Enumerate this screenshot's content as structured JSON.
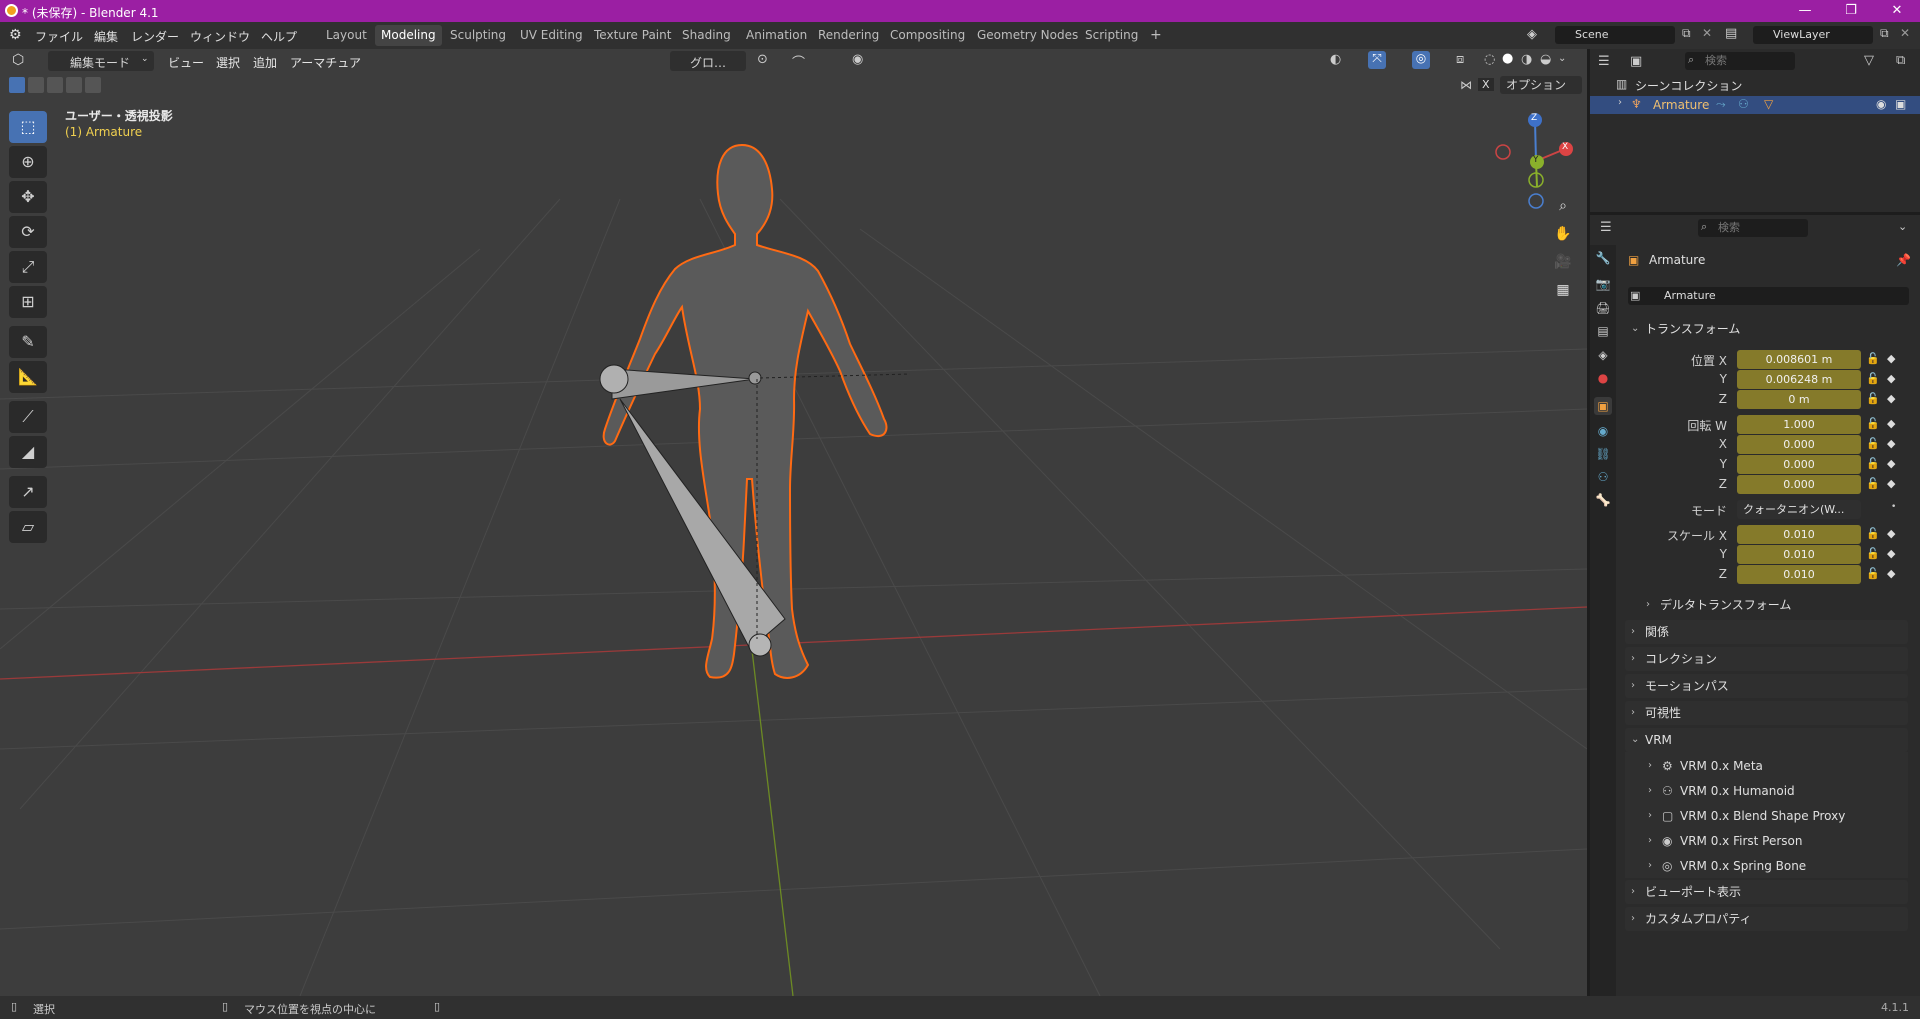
{
  "window": {
    "title": "* (未保存) - Blender 4.1",
    "minimize": "—",
    "restore": "❐",
    "close": "✕"
  },
  "menu": {
    "items": [
      "ファイル",
      "編集",
      "レンダー",
      "ウィンドウ",
      "ヘルプ"
    ]
  },
  "workspaces": {
    "tabs": [
      "Layout",
      "Modeling",
      "Sculpting",
      "UV Editing",
      "Texture Paint",
      "Shading",
      "Animation",
      "Rendering",
      "Compositing",
      "Geometry Nodes",
      "Scripting"
    ],
    "active": "Modeling",
    "add": "+"
  },
  "scene": {
    "name": "Scene",
    "view_layer": "ViewLayer"
  },
  "viewport": {
    "mode": "編集モード",
    "menus": [
      "ビュー",
      "選択",
      "追加",
      "アーマチュア"
    ],
    "orientation": "グロ…",
    "options": "オプション",
    "overlay_label": "ユーザー・透視投影",
    "object_label": "(1) Armature",
    "x_label": "X",
    "gizmo": {
      "z": "Z",
      "y": "Y",
      "x": "X"
    }
  },
  "outliner": {
    "search_placeholder": "検索",
    "collection": "シーンコレクション",
    "item": "Armature"
  },
  "properties": {
    "search_placeholder": "検索",
    "object_name": "Armature",
    "data_name": "Armature",
    "transform": {
      "header": "トランスフォーム",
      "location_label": "位置 X",
      "location": [
        "0.008601 m",
        "0.006248 m",
        "0 m"
      ],
      "rotation_label": "回転 W",
      "rotation": [
        "1.000",
        "0.000",
        "0.000",
        "0.000"
      ],
      "mode_label": "モード",
      "mode_value": "クォータニオン(W...",
      "scale_label": "スケール X",
      "scale": [
        "0.010",
        "0.010",
        "0.010"
      ],
      "axis_y": "Y",
      "axis_z": "Z",
      "axis_x": "X",
      "delta": "デルタトランスフォーム"
    },
    "panels": [
      "関係",
      "コレクション",
      "モーションパス",
      "可視性"
    ],
    "vrm": {
      "header": "VRM",
      "items": [
        "VRM 0.x Meta",
        "VRM 0.x Humanoid",
        "VRM 0.x Blend Shape Proxy",
        "VRM 0.x First Person",
        "VRM 0.x Spring Bone"
      ]
    },
    "panels_after": [
      "ビューポート表示",
      "カスタムプロパティ"
    ]
  },
  "status": {
    "select": "選択",
    "center_view": "マウス位置を視点の中心に",
    "version": "4.1.1"
  },
  "colors": {
    "title_bar": "#9b1fa3",
    "active_tab": "#4772b3",
    "field_animated": "#857a2a",
    "selection_outline": "#ff6a13"
  }
}
